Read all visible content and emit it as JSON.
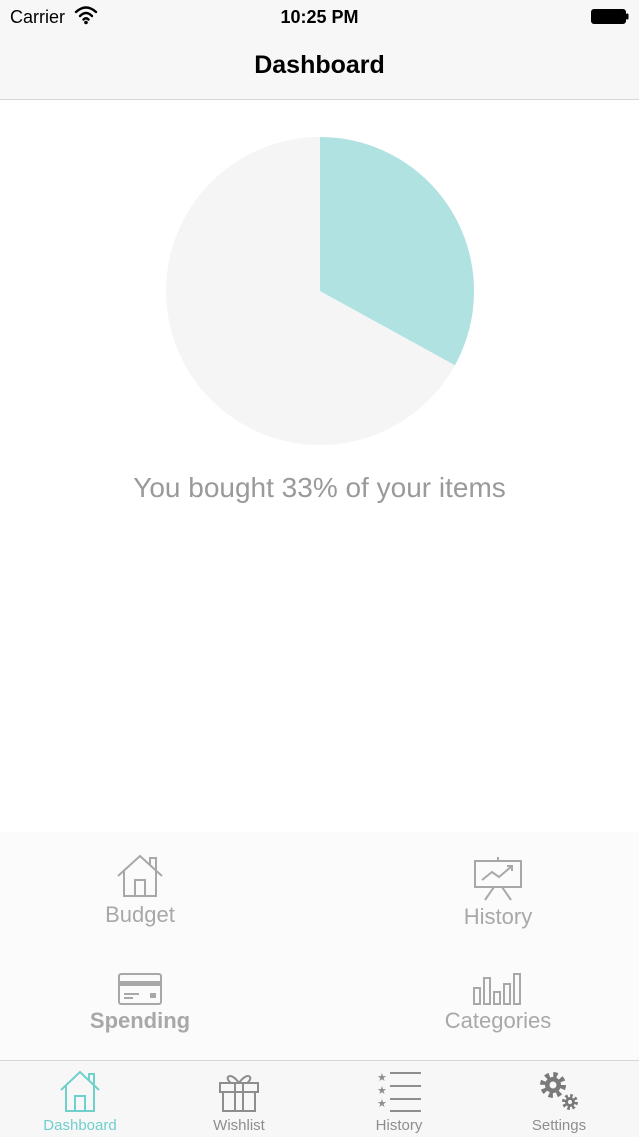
{
  "status_bar": {
    "carrier": "Carrier",
    "time": "10:25 PM",
    "wifi_icon": "wifi-icon",
    "battery_icon": "battery-icon"
  },
  "nav": {
    "title": "Dashboard"
  },
  "pie": {
    "bought_percent": 33,
    "bought_color": "#b1e2e2",
    "remaining_color": "#f5f5f5"
  },
  "summary_text": "You bought 33% of your items",
  "quick_actions": [
    {
      "label": "Budget",
      "icon": "house-icon"
    },
    {
      "label": "History",
      "icon": "chart-board-icon"
    },
    {
      "label": "Spending",
      "icon": "credit-card-icon"
    },
    {
      "label": "Categories",
      "icon": "bar-chart-icon"
    }
  ],
  "tabs": [
    {
      "label": "Dashboard",
      "icon": "house-icon",
      "active": true
    },
    {
      "label": "Wishlist",
      "icon": "gift-icon",
      "active": false
    },
    {
      "label": "History",
      "icon": "star-list-icon",
      "active": false
    },
    {
      "label": "Settings",
      "icon": "gears-icon",
      "active": false
    }
  ],
  "colors": {
    "accent": "#6fd0cc",
    "inactive": "#8e8e8e",
    "label_gray": "#a8a8a8"
  }
}
